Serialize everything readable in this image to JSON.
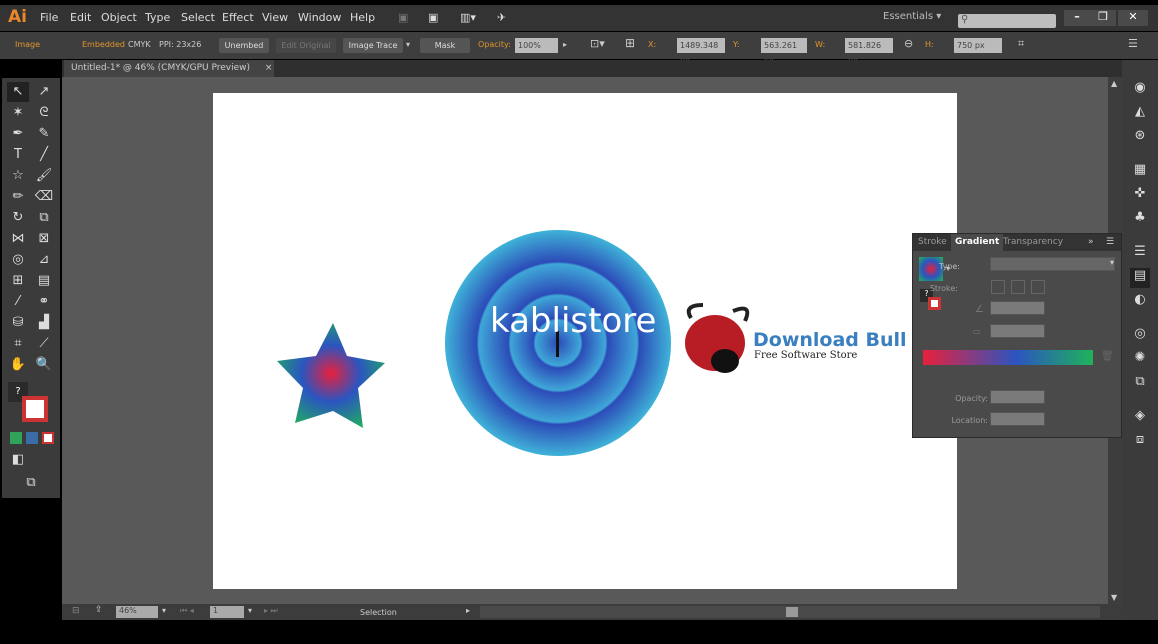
{
  "app": {
    "logo": "Ai",
    "menu": [
      "File",
      "Edit",
      "Object",
      "Type",
      "Select",
      "Effect",
      "View",
      "Window",
      "Help"
    ],
    "workspace": "Essentials ▾",
    "search_placeholder": "",
    "window_controls": [
      "–",
      "❐",
      "✕"
    ]
  },
  "control": {
    "object_type": "Image",
    "embedded": "Embedded",
    "color_mode": "CMYK",
    "ppi": "PPI: 23x26",
    "unembed": "Unembed",
    "edit_original": "Edit Original",
    "image_trace": "Image Trace",
    "mask": "Mask",
    "opacity_label": "Opacity:",
    "opacity": "100%",
    "x_label": "X:",
    "x": "1489.348 px",
    "y_label": "Y:",
    "y": "563.261 px",
    "w_label": "W:",
    "w": "581.826 px",
    "h_label": "H:",
    "h": "750 px"
  },
  "document_tab": {
    "title": "Untitled-1* @ 46% (CMYK/GPU Preview)",
    "close": "×"
  },
  "canvas": {
    "watermark": "kablistore",
    "logo_title": "Download Bull",
    "logo_subtitle": "Free Software Store"
  },
  "gradient_panel": {
    "tabs": [
      "Stroke",
      "Gradient",
      "Transparency"
    ],
    "active_tab": "Gradient",
    "type_label": "Type:",
    "stroke_label": "Stroke:",
    "opacity_label": "Opacity:",
    "location_label": "Location:",
    "gradient_colors": [
      "#e8203c",
      "#2b55c0",
      "#1fb35a"
    ]
  },
  "status": {
    "zoom": "46%",
    "artboard": "1",
    "tool": "Selection"
  },
  "colors": {
    "accent": "#e0962c",
    "canvas": "#595959"
  }
}
